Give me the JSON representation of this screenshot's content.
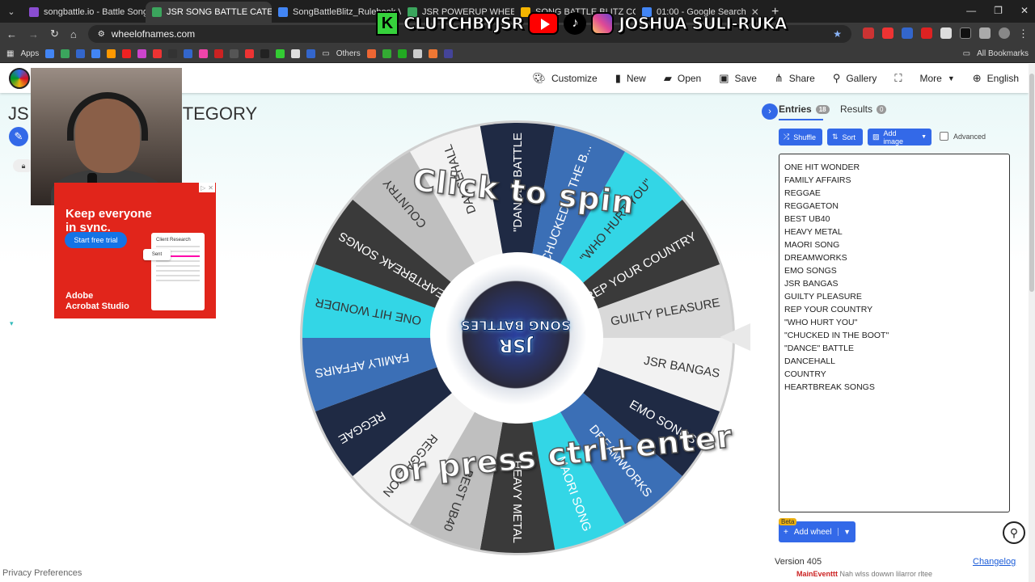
{
  "browser": {
    "tabs": [
      {
        "title": "songbattle.io - Battle Songs ag",
        "color": "#8a4dd1",
        "active": false
      },
      {
        "title": "JSR SONG BATTLE CATEGORY",
        "color": "#3ba55d",
        "active": true
      },
      {
        "title": "SongBattleBlitz_Rulebook V...",
        "color": "#4285f4",
        "active": false
      },
      {
        "title": "JSR POWERUP WHEEL",
        "color": "#3ba55d",
        "active": false
      },
      {
        "title": "SONG BATTLE BLITZ COMP",
        "color": "#f4b400",
        "active": false
      },
      {
        "title": "01:00 - Google Search",
        "color": "#4285f4",
        "active": false
      }
    ],
    "url": "wheelofnames.com",
    "bookmarks": {
      "apps": "Apps",
      "others": "Others",
      "all": "All Bookmarks"
    }
  },
  "overlay": {
    "handle": "CLUTCHBYJSR",
    "name": "JOSHUA SULI-RUKA"
  },
  "app": {
    "menu": [
      {
        "label": "Customize",
        "icon": "palette-icon"
      },
      {
        "label": "New",
        "icon": "file-icon"
      },
      {
        "label": "Open",
        "icon": "folder-icon"
      },
      {
        "label": "Save",
        "icon": "save-icon"
      },
      {
        "label": "Share",
        "icon": "share-icon"
      },
      {
        "label": "Gallery",
        "icon": "search-icon"
      },
      {
        "label": "",
        "icon": "fullscreen-icon"
      },
      {
        "label": "More",
        "icon": "chevron-down-icon"
      },
      {
        "label": "English",
        "icon": "globe-icon"
      }
    ],
    "title_start": "JS",
    "title_end": "TEGORY"
  },
  "ad": {
    "headline": "Keep everyone in sync.",
    "cta": "Start free trial",
    "doc_title": "Client Research",
    "sent": "Sent",
    "brand_line1": "Adobe",
    "brand_line2": "Acrobat Studio"
  },
  "wheel": {
    "spin_top": "Click to spin",
    "spin_bottom": "or press ctrl+enter",
    "logo_line1": "JSR",
    "logo_line2": "SONG BATTLES",
    "segments": [
      {
        "label": "GUILTY PLEASURE",
        "color": "#d9d9d9",
        "text": "#333333"
      },
      {
        "label": "JSR BANGAS",
        "color": "#f2f2f2",
        "text": "#333333"
      },
      {
        "label": "EMO SONGS",
        "color": "#1f2a44",
        "text": "#ffffff"
      },
      {
        "label": "DREAMWORKS",
        "color": "#3b6fb6",
        "text": "#ffffff"
      },
      {
        "label": "MAORI SONG",
        "color": "#33d6e6",
        "text": "#ffffff"
      },
      {
        "label": "HEAVY METAL",
        "color": "#3a3a3a",
        "text": "#ffffff"
      },
      {
        "label": "BEST UB40",
        "color": "#bfbfbf",
        "text": "#333333"
      },
      {
        "label": "REGGAETON",
        "color": "#f2f2f2",
        "text": "#333333"
      },
      {
        "label": "REGGAE",
        "color": "#1f2a44",
        "text": "#ffffff"
      },
      {
        "label": "FAMILY AFFAIRS",
        "color": "#3b6fb6",
        "text": "#ffffff"
      },
      {
        "label": "ONE HIT WONDER",
        "color": "#33d6e6",
        "text": "#333333"
      },
      {
        "label": "HEARTBREAK SONGS",
        "color": "#3a3a3a",
        "text": "#ffffff"
      },
      {
        "label": "COUNTRY",
        "color": "#bfbfbf",
        "text": "#333333"
      },
      {
        "label": "DANCEHALL",
        "color": "#f2f2f2",
        "text": "#333333"
      },
      {
        "label": "\"DANCE\" BATTLE",
        "color": "#1f2a44",
        "text": "#ffffff"
      },
      {
        "label": "\"CHUCKED IN THE B...",
        "color": "#3b6fb6",
        "text": "#ffffff"
      },
      {
        "label": "\"WHO HURT YOU\"",
        "color": "#33d6e6",
        "text": "#333333"
      },
      {
        "label": "REP YOUR COUNTRY",
        "color": "#3a3a3a",
        "text": "#ffffff"
      }
    ]
  },
  "panel": {
    "entries_tab": "Entries",
    "entries_count": "18",
    "results_tab": "Results",
    "results_count": "0",
    "shuffle": "Shuffle",
    "sort": "Sort",
    "add_image": "Add image",
    "advanced": "Advanced",
    "entries": [
      "ONE HIT WONDER",
      "FAMILY AFFAIRS",
      "REGGAE",
      "REGGAETON",
      "BEST UB40",
      "HEAVY METAL",
      "MAORI SONG",
      "DREAMWORKS",
      "EMO SONGS",
      "JSR BANGAS",
      "GUILTY PLEASURE",
      "REP YOUR COUNTRY",
      "\"WHO HURT YOU\"",
      "\"CHUCKED IN THE BOOT\"",
      "\"DANCE\" BATTLE",
      "DANCEHALL",
      "COUNTRY",
      "HEARTBREAK SONGS"
    ],
    "beta": "Beta",
    "add_wheel": "Add wheel",
    "version": "Version 405",
    "changelog": "Changelog"
  },
  "footer": {
    "privacy": "Privacy Preferences",
    "chat_user": "MainEventtt",
    "chat_text": "Nah wlss dowwn lilarror rltee"
  }
}
